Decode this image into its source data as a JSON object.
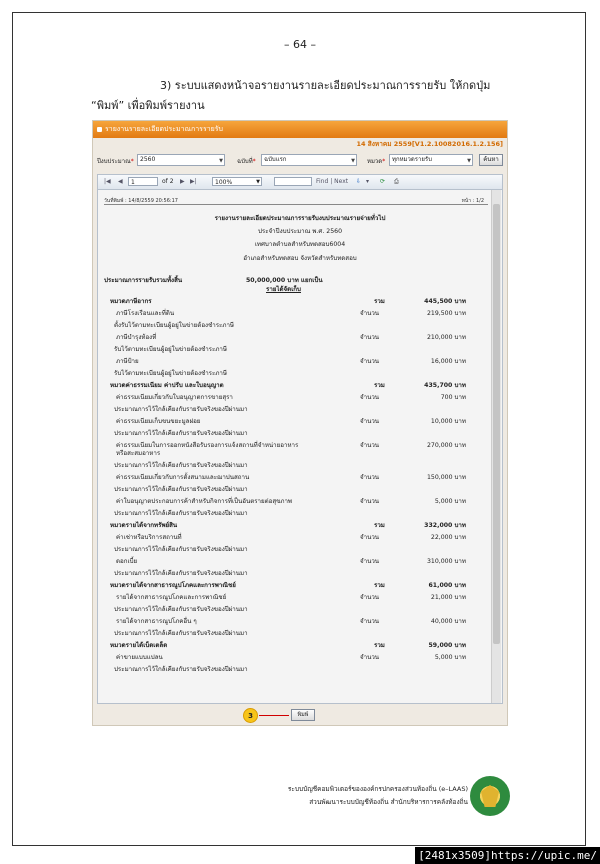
{
  "page_number": "– 64 –",
  "instruction": {
    "line1": "3)  ระบบแสดงหน้าจอรายงานรายละเอียดประมาณการรายรับ ให้กดปุ่ม",
    "line2": "“พิมพ์” เพื่อพิมพ์รายงาน"
  },
  "screenshot": {
    "title": "รายงานรายละเอียดประมาณการรายรับ",
    "version": "14 สิงหาคม 2559[V1.2.10082016.1.2.156]",
    "filters": {
      "year_label": "ปีงบประมาณ",
      "year_value": "2560",
      "edition_label": "ฉบับที่",
      "edition_value": "ฉบับแรก",
      "category_label": "หมวด",
      "category_value": "ทุกหมวดรายรับ",
      "search_button": "ค้นหา"
    },
    "viewer": {
      "page_input": "1",
      "page_of": "of 2",
      "zoom": "100%",
      "find": "Find | Next",
      "print_date": "วันที่พิมพ์ : 14/8/2559 20:56:17",
      "page_label": "หน้า : 1/2"
    },
    "report": {
      "heading": "รายงานรายละเอียดประมาณการรายรับงบประมาณรายจ่ายทั่วไป",
      "fiscal_year": "ประจำปีงบประมาณ พ.ศ. 2560",
      "org": "เทศบาลตำบลสำหรับทดสอบ6004",
      "location": "อำเภอสำหรับทดสอบ  จังหวัดสำหรับทดสอบ",
      "total_label": "ประมาณการรายรับรวมทั้งสิ้น",
      "total_value": "50,000,000  บาท  แยกเป็น",
      "section": "รายได้จัดเก็บ",
      "rows": [
        {
          "kind": "cat",
          "text": "หมวดภาษีอากร",
          "label": "รวม",
          "amount": "445,500  บาท"
        },
        {
          "kind": "item",
          "text": "ภาษีโรงเรือนและที่ดิน",
          "label": "จำนวน",
          "amount": "219,500  บาท"
        },
        {
          "kind": "note",
          "text": "ตั้งรับไว้ตามทะเบียนผู้อยู่ในข่ายต้องชำระภาษี"
        },
        {
          "kind": "item",
          "text": "ภาษีบำรุงท้องที่",
          "label": "จำนวน",
          "amount": "210,000  บาท"
        },
        {
          "kind": "note",
          "text": "รับไว้ตามทะเบียนผู้อยู่ในข่ายต้องชำระภาษี"
        },
        {
          "kind": "item",
          "text": "ภาษีป้าย",
          "label": "จำนวน",
          "amount": "16,000  บาท"
        },
        {
          "kind": "note",
          "text": "รับไว้ตามทะเบียนผู้อยู่ในข่ายต้องชำระภาษี"
        },
        {
          "kind": "cat",
          "text": "หมวดค่าธรรมเนียม ค่าปรับ และใบอนุญาต",
          "label": "รวม",
          "amount": "435,700  บาท"
        },
        {
          "kind": "item",
          "text": "ค่าธรรมเนียมเกี่ยวกับใบอนุญาตการขายสุรา",
          "label": "จำนวน",
          "amount": "700  บาท"
        },
        {
          "kind": "note",
          "text": "ประมาณการไว้ใกล้เคียงกับรายรับจริงของปีผ่านมา"
        },
        {
          "kind": "item",
          "text": "ค่าธรรมเนียมเก็บขนขยะมูลฝอย",
          "label": "จำนวน",
          "amount": "10,000  บาท"
        },
        {
          "kind": "note",
          "text": "ประมาณการไว้ใกล้เคียงกับรายรับจริงของปีผ่านมา"
        },
        {
          "kind": "item2",
          "text": "ค่าธรรมเนียมในการออกหนังสือรับรองการแจ้งสถานที่จำหน่ายอาหาร",
          "text2": "หรือสะสมอาหาร",
          "label": "จำนวน",
          "amount": "270,000  บาท"
        },
        {
          "kind": "note",
          "text": "ประมาณการไว้ใกล้เคียงกับรายรับจริงของปีผ่านมา"
        },
        {
          "kind": "item",
          "text": "ค่าธรรมเนียมเกี่ยวกับการตั้งสนามและฌาปนสถาน",
          "label": "จำนวน",
          "amount": "150,000  บาท"
        },
        {
          "kind": "note",
          "text": "ประมาณการไว้ใกล้เคียงกับรายรับจริงของปีผ่านมา"
        },
        {
          "kind": "item",
          "text": "ค่าใบอนุญาตประกอบการค้าสำหรับกิจการที่เป็นอันตรายต่อสุขภาพ",
          "label": "จำนวน",
          "amount": "5,000  บาท"
        },
        {
          "kind": "note",
          "text": "ประมาณการไว้ใกล้เคียงกับรายรับจริงของปีผ่านมา"
        },
        {
          "kind": "cat",
          "text": "หมวดรายได้จากทรัพย์สิน",
          "label": "รวม",
          "amount": "332,000  บาท"
        },
        {
          "kind": "item",
          "text": "ค่าเช่าหรือบริการสถานที่",
          "label": "จำนวน",
          "amount": "22,000  บาท"
        },
        {
          "kind": "note",
          "text": "ประมาณการไว้ใกล้เคียงกับรายรับจริงของปีผ่านมา"
        },
        {
          "kind": "item",
          "text": "ดอกเบี้ย",
          "label": "จำนวน",
          "amount": "310,000  บาท"
        },
        {
          "kind": "note",
          "text": "ประมาณการไว้ใกล้เคียงกับรายรับจริงของปีผ่านมา"
        },
        {
          "kind": "cat",
          "text": "หมวดรายได้จากสาธารณูปโภคและการพาณิชย์",
          "label": "รวม",
          "amount": "61,000  บาท"
        },
        {
          "kind": "item",
          "text": "รายได้จากสาธารณูปโภคและการพาณิชย์",
          "label": "จำนวน",
          "amount": "21,000  บาท"
        },
        {
          "kind": "note",
          "text": "ประมาณการไว้ใกล้เคียงกับรายรับจริงของปีผ่านมา"
        },
        {
          "kind": "item",
          "text": "รายได้จากสาธารณูปโภคอื่น ๆ",
          "label": "จำนวน",
          "amount": "40,000  บาท"
        },
        {
          "kind": "note",
          "text": "ประมาณการไว้ใกล้เคียงกับรายรับจริงของปีผ่านมา"
        },
        {
          "kind": "cat",
          "text": "หมวดรายได้เบ็ดเตล็ด",
          "label": "รวม",
          "amount": "59,000  บาท"
        },
        {
          "kind": "item",
          "text": "ค่าขายแบบแปลน",
          "label": "จำนวน",
          "amount": "5,000  บาท"
        },
        {
          "kind": "note",
          "text": "ประมาณการไว้ใกล้เคียงกับรายรับจริงของปีผ่านมา"
        }
      ]
    },
    "callout": "3",
    "print_button": "พิมพ์"
  },
  "footer": {
    "line1": "ระบบบัญชีคอมพิวเตอร์ขององค์กรปกครองส่วนท้องถิ่น (e–LAAS)",
    "line2": "ส่วนพัฒนาระบบบัญชีท้องถิ่น   สำนักบริหารการคลังท้องถิ่น"
  },
  "watermark": "[2481x3509]https://upic.me/"
}
